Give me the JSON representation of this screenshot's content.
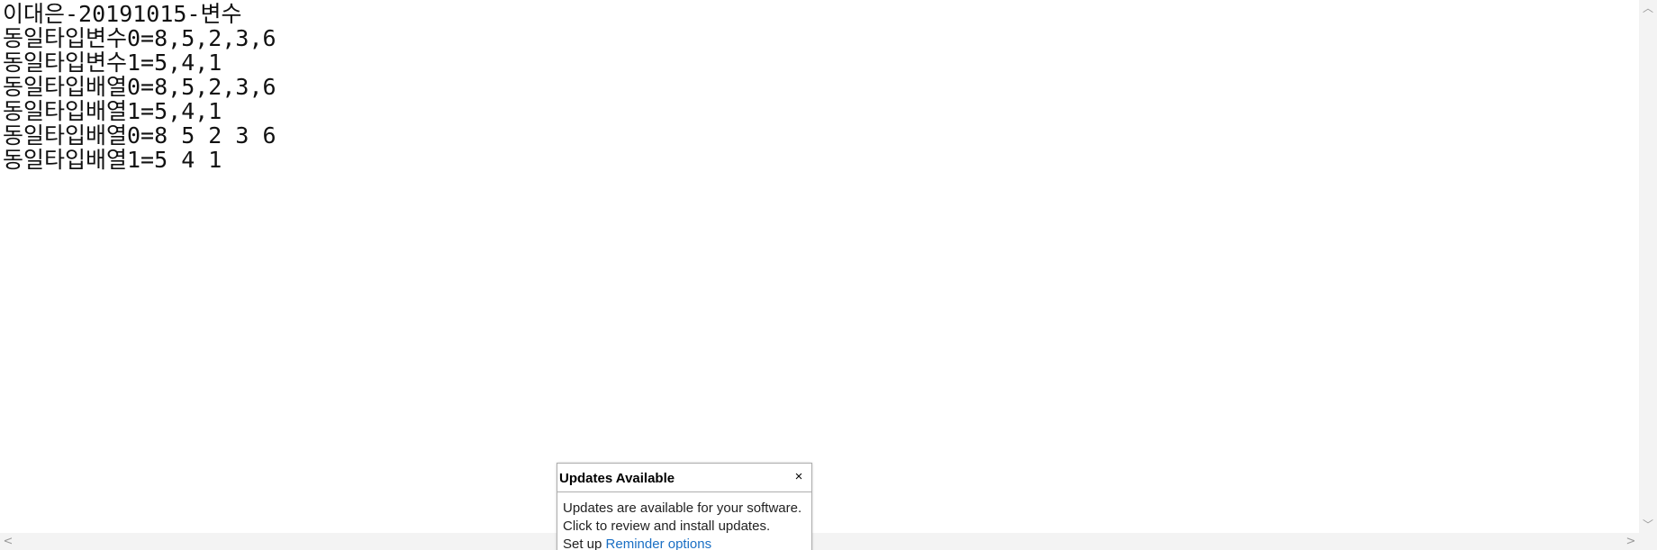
{
  "editor": {
    "lines": [
      "이대은-20191015-변수",
      "동일타입변수0=8,5,2,3,6",
      "동일타입변수1=5,4,1",
      "동일타입배열0=8,5,2,3,6",
      "동일타입배열1=5,4,1",
      "동일타입배열0=8 5 2 3 6",
      "동일타입배열1=5 4 1"
    ]
  },
  "scrollbars": {
    "up_glyph": "︿",
    "down_glyph": "﹀",
    "left_glyph": "<",
    "right_glyph": ">"
  },
  "popup": {
    "title": "Updates Available",
    "close_glyph": "×",
    "line1": "Updates are available for your software.",
    "line2": "Click to review and install updates.",
    "setup_prefix": "Set up ",
    "setup_link": "Reminder options"
  }
}
